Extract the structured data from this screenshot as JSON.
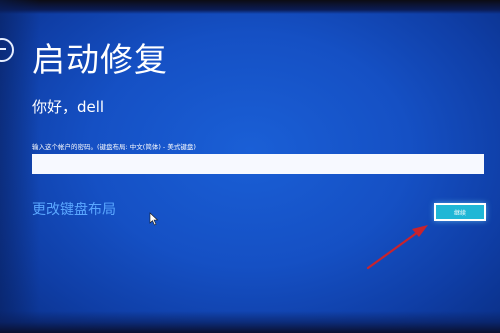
{
  "screen": {
    "title": "启动修复",
    "greeting": "你好，dell",
    "prompt": "输入这个帐户的密码。(键盘布局: 中文(简体) - 美式键盘)",
    "password_value": "",
    "keyboard_link": "更改键盘布局",
    "continue_label": "继续"
  },
  "icons": {
    "back": "back-arrow-icon",
    "cursor": "mouse-pointer-icon",
    "annotation": "red-arrow-icon"
  },
  "colors": {
    "background": "#1550c4",
    "link": "#5aa7ff",
    "button": "#1fb7d6",
    "annotation_arrow": "#c8232d"
  }
}
